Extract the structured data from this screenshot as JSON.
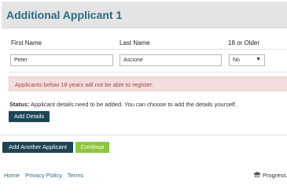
{
  "card": {
    "title": "Additional Applicant 1",
    "columns": {
      "first_name": "First Name",
      "last_name": "Last Name",
      "age": "18 or Older"
    },
    "first_name_value": "Peter",
    "last_name_value": "Ascione",
    "age_value": "No"
  },
  "alert": {
    "text": "Applicants below 18 years will not be able to register."
  },
  "status": {
    "label": "Status:",
    "text": "Applicant details need to be added. You can choose to add the details yourself."
  },
  "buttons": {
    "add_details": "Add Details",
    "add_another": "Add Another Applicant",
    "continue": "Continue"
  },
  "footer": {
    "links": [
      "Home",
      "Privacy Policy",
      "Terms"
    ],
    "progress_label": "Progress"
  },
  "colors": {
    "title": "#2c6b84",
    "dark_button": "#1d4556",
    "continue_button": "#8dc63f",
    "alert_bg": "#f2dede",
    "alert_text": "#a94442"
  }
}
